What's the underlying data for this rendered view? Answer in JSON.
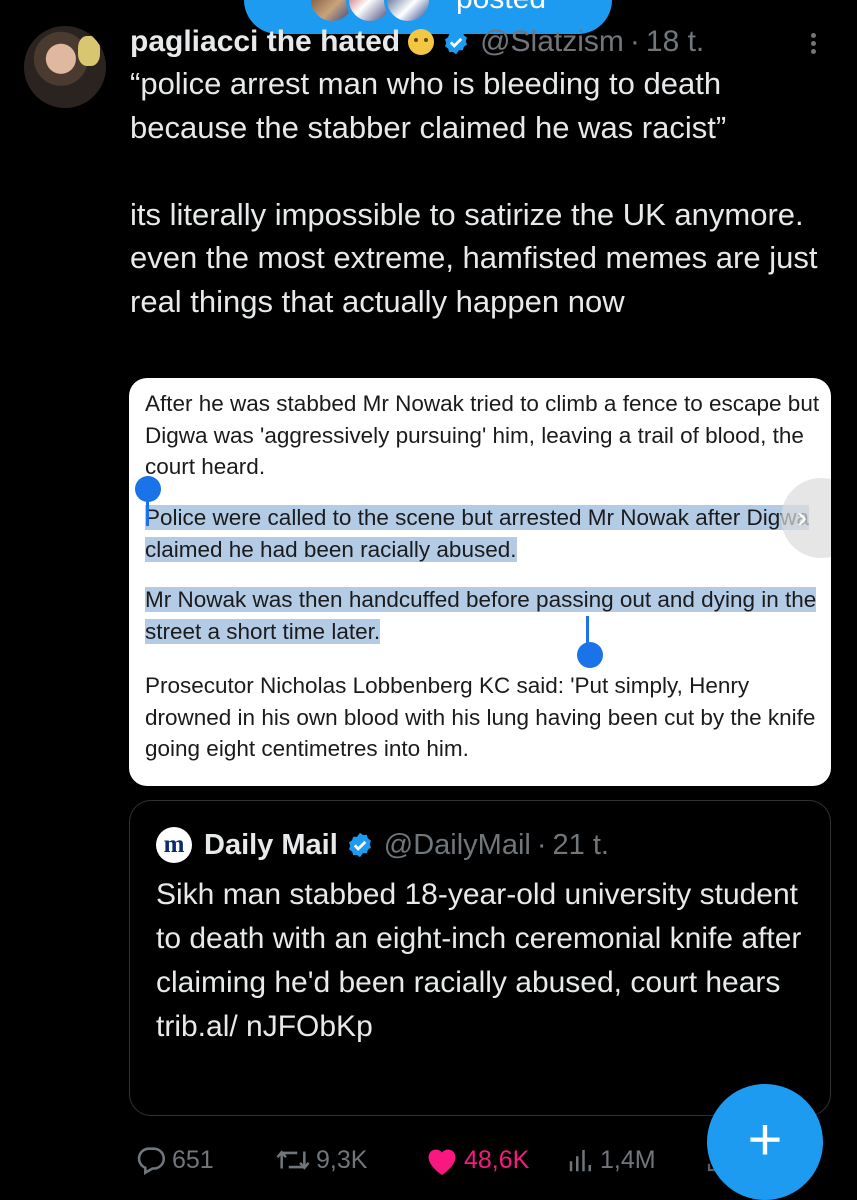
{
  "posted_pill": {
    "label": "posted"
  },
  "tweet": {
    "display_name": "pagliacci the hated",
    "handle": "@Slatzism",
    "separator": "·",
    "time": "18 t.",
    "text": "“police arrest man who is bleeding to death because the stabber claimed he was racist”\n\nits literally impossible to satirize the UK anymore. even the most extreme, hamfisted memes are just real things that actually happen now"
  },
  "article": {
    "p1": "After he was stabbed Mr Nowak tried to climb a fence to escape but Digwa was 'aggressively pursuing' him, leaving a trail of blood, the court heard.",
    "p2": "Police were called to the scene but arrested Mr Nowak after Digwa claimed he had been racially abused.",
    "p3": "Mr Nowak was then handcuffed before passing out and dying in the street a short time later.",
    "p4": "Prosecutor Nicholas Lobbenberg KC said: 'Put simply, Henry drowned in his own blood with his lung having been cut by the knife going eight centimetres into him."
  },
  "quote": {
    "logo_letter": "m",
    "display_name": "Daily Mail",
    "handle": "@DailyMail",
    "separator": "·",
    "time": "21 t.",
    "text": "Sikh man stabbed 18-year-old university student to death with an eight-inch ceremonial knife after claiming he'd been racially abused, court hears trib.al/ nJFObKp"
  },
  "actions": {
    "replies": "651",
    "reposts": "9,3K",
    "likes": "48,6K",
    "views": "1,4M"
  },
  "fab": {
    "label": "+"
  },
  "colors": {
    "background": "#000000",
    "accent": "#1d9bf0",
    "like": "#f91880",
    "muted": "#71767b",
    "text": "#e7e9ea"
  },
  "icons": [
    "verified-badge-icon",
    "more-icon",
    "reply-icon",
    "repost-icon",
    "like-icon",
    "views-icon",
    "share-icon",
    "compose-icon"
  ]
}
